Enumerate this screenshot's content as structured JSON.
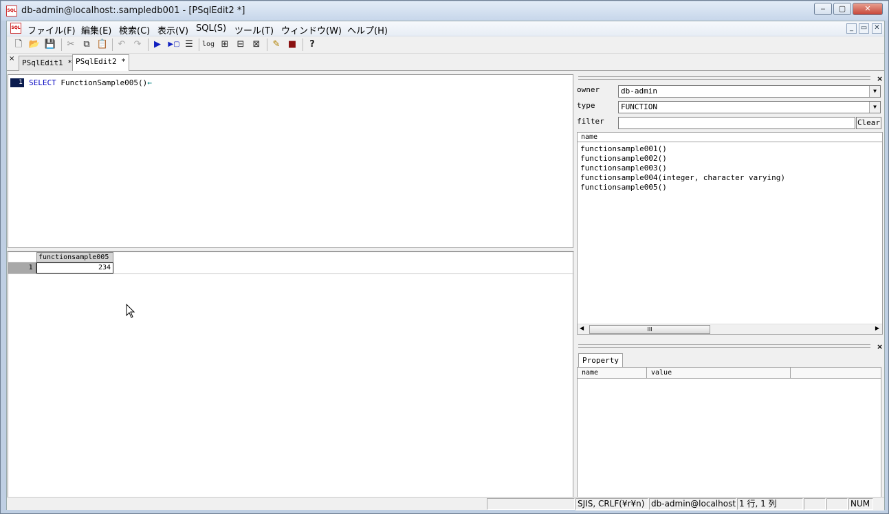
{
  "window": {
    "title": "db-admin@localhost:.sampledb001 - [PSqlEdit2 *]",
    "icon_label": "SQL",
    "controls": {
      "minimize": "‒",
      "restore": "▢",
      "close": "✕"
    }
  },
  "menubar": {
    "icon_label": "SQL",
    "items": [
      "ファイル(F)",
      "編集(E)",
      "検索(C)",
      "表示(V)",
      "SQL(S)",
      "ツール(T)",
      "ウィンドウ(W)",
      "ヘルプ(H)"
    ],
    "mdi_controls": {
      "minimize": "_",
      "restore": "▭",
      "close": "✕"
    }
  },
  "toolbar": {
    "buttons": [
      {
        "name": "new-file",
        "glyph": "🗋"
      },
      {
        "name": "open-file",
        "glyph": "📂"
      },
      {
        "name": "save-file",
        "glyph": "💾"
      },
      {
        "name": "cut",
        "glyph": "✂"
      },
      {
        "name": "copy",
        "glyph": "⧉"
      },
      {
        "name": "paste",
        "glyph": "📋"
      },
      {
        "name": "undo",
        "glyph": "↶"
      },
      {
        "name": "redo",
        "glyph": "↷"
      },
      {
        "name": "execute",
        "glyph": "▶"
      },
      {
        "name": "execute-step",
        "glyph": "▶▢"
      },
      {
        "name": "explain",
        "glyph": "☰"
      },
      {
        "name": "log",
        "glyph": "log"
      },
      {
        "name": "grid-a",
        "glyph": "⊞"
      },
      {
        "name": "grid-b",
        "glyph": "⊟"
      },
      {
        "name": "grid-c",
        "glyph": "⊠"
      },
      {
        "name": "pencil",
        "glyph": "✎"
      },
      {
        "name": "book",
        "glyph": "■"
      },
      {
        "name": "help",
        "glyph": "?"
      }
    ]
  },
  "tabs": [
    {
      "label": "PSqlEdit1 *",
      "active": false
    },
    {
      "label": "PSqlEdit2 *",
      "active": true
    }
  ],
  "tabstrip_close": "×",
  "editor": {
    "line_number": "1",
    "keyword": "SELECT",
    "rest": " FunctionSample005()",
    "eol_marker": "←"
  },
  "result_grid": {
    "columns": [
      "functionsample005"
    ],
    "rows": [
      {
        "row_num": "1",
        "values": [
          "234"
        ]
      }
    ]
  },
  "object_browser": {
    "close": "×",
    "owner_label": "owner",
    "owner_value": "db-admin",
    "type_label": "type",
    "type_value": "FUNCTION",
    "filter_label": "filter",
    "filter_value": "",
    "clear_label": "Clear",
    "list_header": "name",
    "items": [
      "functionsample001()",
      "functionsample002()",
      "functionsample003()",
      "functionsample004(integer, character varying)",
      "functionsample005()"
    ],
    "scroll_thumb_glyph": "III"
  },
  "property_panel": {
    "close": "×",
    "tab_label": "Property",
    "columns": [
      "name",
      "value"
    ]
  },
  "statusbar": {
    "encoding": "SJIS, CRLF(¥r¥n)",
    "connection": "db-admin@localhost:",
    "position": "1 行, 1 列",
    "num": "NUM"
  },
  "colors": {
    "title_gradient": "#c7d6ea",
    "keyword": "#0000c0",
    "line_number_bg": "#0a1b4e",
    "execute_blue": "#1020c0"
  }
}
